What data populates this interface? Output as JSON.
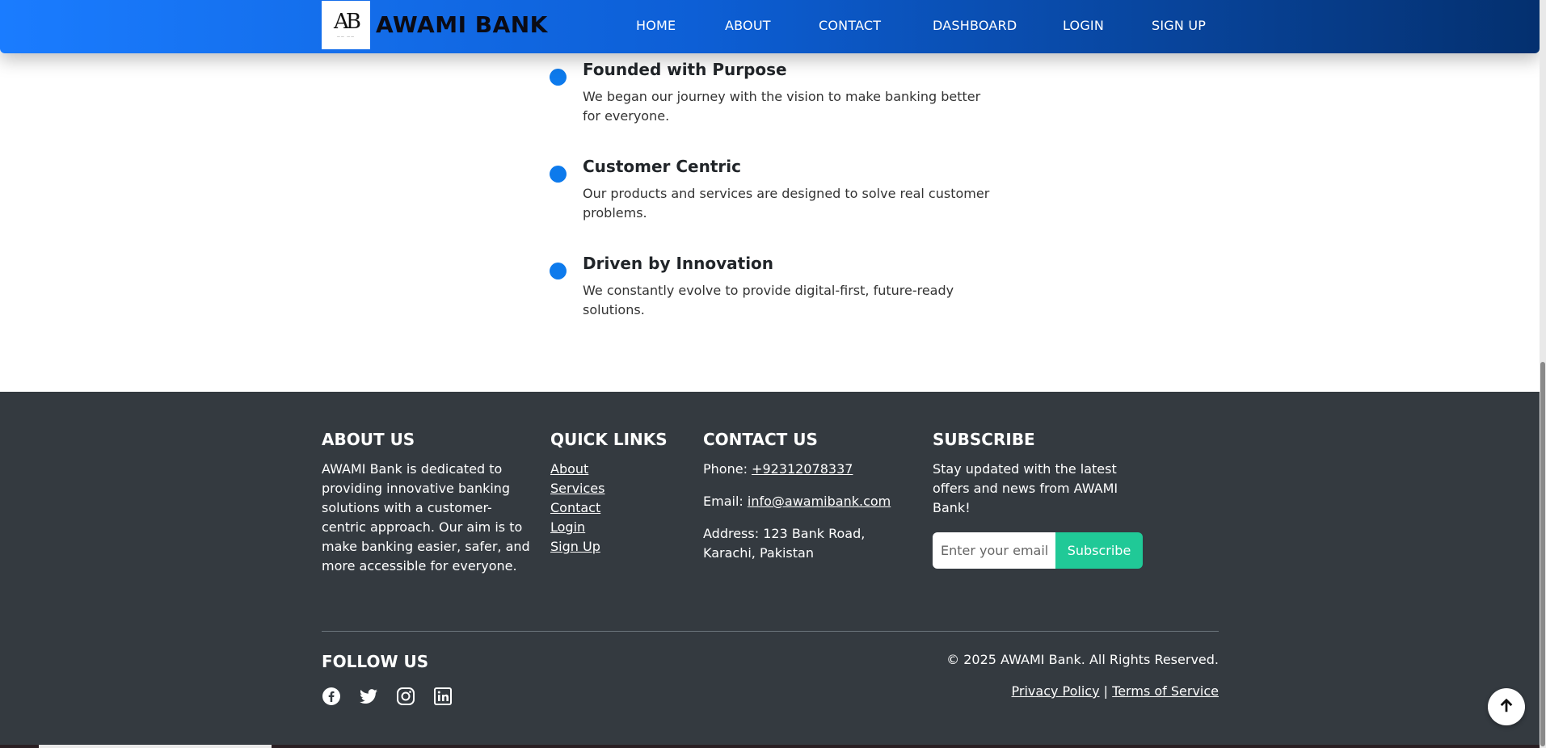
{
  "header": {
    "logo_mark": "AB",
    "brand": "AWAMI BANK",
    "nav": [
      "HOME",
      "ABOUT",
      "CONTACT",
      "DASHBOARD",
      "LOGIN",
      "SIGN UP"
    ]
  },
  "timeline": [
    {
      "title": "Founded with Purpose",
      "desc": "We began our journey with the vision to make banking better for everyone."
    },
    {
      "title": "Customer Centric",
      "desc": "Our products and services are designed to solve real customer problems."
    },
    {
      "title": "Driven by Innovation",
      "desc": "We constantly evolve to provide digital-first, future-ready solutions."
    }
  ],
  "footer": {
    "about": {
      "heading": "ABOUT US",
      "text": "AWAMI Bank is dedicated to providing innovative banking solutions with a customer-centric approach. Our aim is to make banking easier, safer, and more accessible for everyone."
    },
    "quick_links": {
      "heading": "QUICK LINKS",
      "links": [
        "About",
        "Services",
        "Contact",
        "Login",
        "Sign Up"
      ]
    },
    "contact": {
      "heading": "CONTACT US",
      "phone_label": "Phone:",
      "phone": "+92312078337",
      "email_label": "Email:",
      "email": "info@awamibank.com",
      "address": "Address: 123 Bank Road, Karachi, Pakistan"
    },
    "subscribe": {
      "heading": "SUBSCRIBE",
      "text": "Stay updated with the latest offers and news from AWAMI Bank!",
      "placeholder": "Enter your email",
      "button": "Subscribe"
    },
    "follow_heading": "FOLLOW US",
    "socials": [
      "facebook-icon",
      "twitter-icon",
      "instagram-icon",
      "linkedin-icon"
    ],
    "copyright": "© 2025 AWAMI Bank. All Rights Reserved.",
    "privacy": "Privacy Policy",
    "separator": "|",
    "terms": "Terms of Service"
  },
  "colors": {
    "nav_gradient_start": "#1a7cff",
    "nav_gradient_end": "#04306f",
    "timeline_dot": "#0d7aec",
    "footer_bg": "#343a40",
    "subscribe_button": "#20c997"
  }
}
